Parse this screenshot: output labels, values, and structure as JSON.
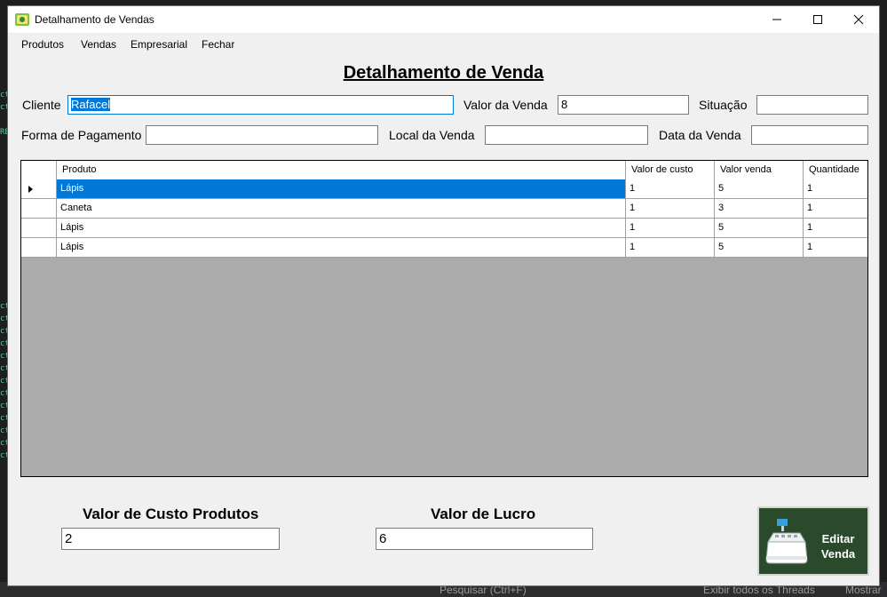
{
  "window": {
    "title": "Detalhamento de Vendas"
  },
  "menu": {
    "items": [
      "Produtos",
      "Vendas",
      "Empresarial",
      "Fechar"
    ]
  },
  "form": {
    "heading": "Detalhamento de Venda",
    "cliente_label": "Cliente",
    "cliente_value": "Rafacel",
    "valor_venda_label": "Valor da Venda",
    "valor_venda_value": "8",
    "situacao_label": "Situação",
    "situacao_value": "",
    "forma_pagamento_label": "Forma de Pagamento",
    "forma_pagamento_value": "",
    "local_venda_label": "Local da Venda",
    "local_venda_value": "",
    "data_venda_label": "Data da Venda",
    "data_venda_value": ""
  },
  "grid": {
    "columns": [
      "Produto",
      "Valor de custo",
      "Valor venda",
      "Quantidade"
    ],
    "rows": [
      [
        "Lápis",
        "1",
        "5",
        "1"
      ],
      [
        "Caneta",
        "1",
        "3",
        "1"
      ],
      [
        "Lápis",
        "1",
        "5",
        "1"
      ],
      [
        "Lápis",
        "1",
        "5",
        "1"
      ]
    ]
  },
  "summary": {
    "custo_label": "Valor de Custo Produtos",
    "custo_value": "2",
    "lucro_label": "Valor de Lucro",
    "lucro_value": "6"
  },
  "edit_button": {
    "line1": "Editar",
    "line2": "Venda"
  },
  "ide_background": {
    "search_text": "Pesquisar (Ctrl+F)",
    "threads_text": "Exibir todos os Threads",
    "show_text": "Mostrar"
  },
  "colors": {
    "accent": "#0078d7",
    "button_bg": "#2b4a2b",
    "grid_bg": "#ababab"
  }
}
